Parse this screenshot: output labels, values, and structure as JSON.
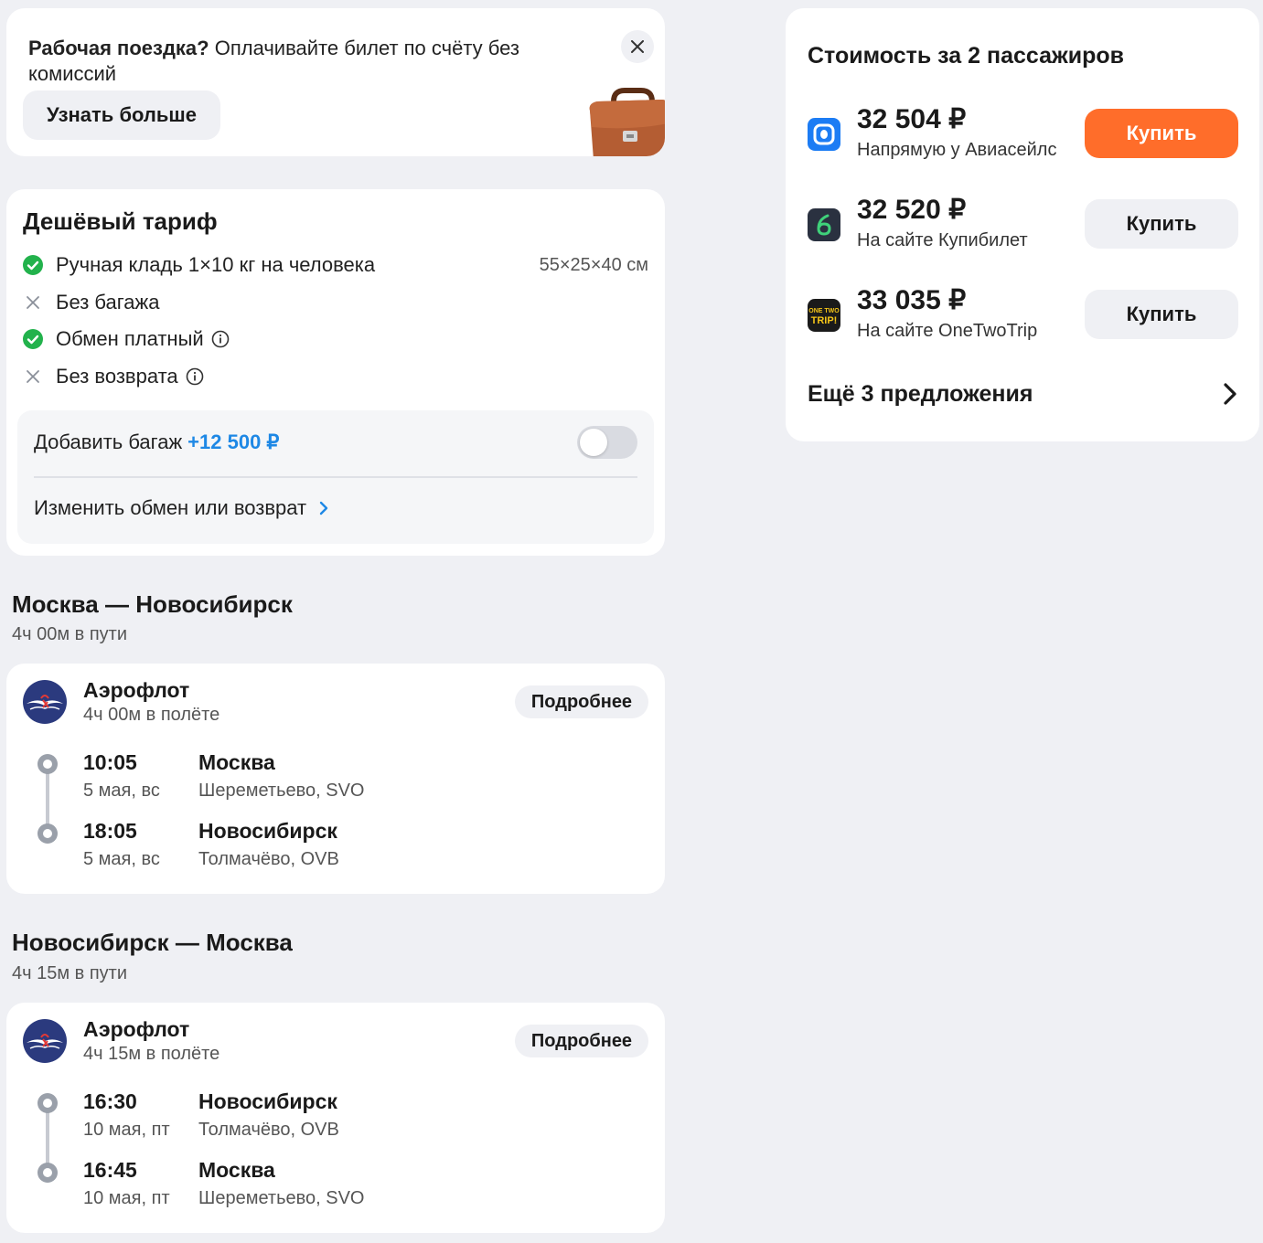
{
  "promo": {
    "title_bold": "Рабочая поездка?",
    "title_rest": " Оплачивайте билет по счёту без комиссий",
    "more_label": "Узнать больше"
  },
  "tariff": {
    "title": "Дешёвый тариф",
    "features": [
      {
        "text": "Ручная кладь 1×10 кг на человека",
        "status": "included"
      },
      {
        "text": "Без багажа",
        "status": "excluded"
      },
      {
        "text": "Обмен платный",
        "status": "included"
      },
      {
        "text": "Без возврата",
        "status": "excluded"
      }
    ],
    "hand_luggage_dims": "55×25×40 см",
    "add_luggage_label": "Добавить багаж",
    "add_luggage_price": "+12 500 ₽",
    "add_luggage_enabled": false,
    "change_label": "Изменить обмен или возврат"
  },
  "routes": [
    {
      "title": "Москва — Новосибирск",
      "duration": "4ч 00м в пути",
      "airline": "Аэрофлот",
      "flight_duration": "4ч 00м в полёте",
      "details_label": "Подробнее",
      "departure": {
        "time": "10:05",
        "date": "5 мая, вс",
        "city": "Москва",
        "airport": "Шереметьево, SVO"
      },
      "arrival": {
        "time": "18:05",
        "date": "5 мая, вс",
        "city": "Новосибирск",
        "airport": "Толмачёво, OVB"
      }
    },
    {
      "title": "Новосибирск — Москва",
      "duration": "4ч 15м в пути",
      "airline": "Аэрофлот",
      "flight_duration": "4ч 15м в полёте",
      "details_label": "Подробнее",
      "departure": {
        "time": "16:30",
        "date": "10 мая, пт",
        "city": "Новосибирск",
        "airport": "Толмачёво, OVB"
      },
      "arrival": {
        "time": "16:45",
        "date": "10 мая, пт",
        "city": "Москва",
        "airport": "Шереметьево, SVO"
      }
    }
  ],
  "prices": {
    "title": "Стоимость за 2 пассажиров",
    "offers": [
      {
        "price": "32 504 ₽",
        "seller": "Напрямую у Авиасейлс",
        "buy_label": "Купить",
        "primary": true,
        "icon": "aviasales-logo"
      },
      {
        "price": "32 520 ₽",
        "seller": "На сайте Купибилет",
        "buy_label": "Купить",
        "primary": false,
        "icon": "kupibilet-logo"
      },
      {
        "price": "33 035 ₽",
        "seller": "На сайте OneTwoTrip",
        "buy_label": "Купить",
        "primary": false,
        "icon": "onetwotrip-logo"
      }
    ],
    "more_offers_label": "Ещё 3 предложения"
  },
  "colors": {
    "accent_orange": "#ff6d2a",
    "link_blue": "#1e88e5",
    "check_green": "#22b24c",
    "background": "#eff0f4"
  }
}
